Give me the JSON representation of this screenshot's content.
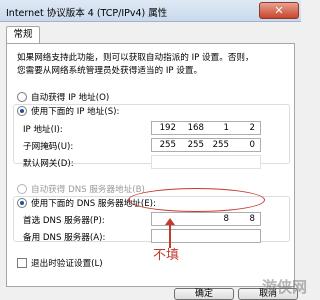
{
  "window": {
    "title": "Internet 协议版本 4 (TCP/IPv4) 属性",
    "close_glyph": "✕"
  },
  "tabs": [
    {
      "label": "常规"
    }
  ],
  "description": {
    "line1": "如果网络支持此功能，则可以获取自动指派的 IP 设置。否则，",
    "line2": "您需要从网络系统管理员处获得适当的 IP 设置。"
  },
  "ip_section": {
    "auto_label": "自动获得 IP 地址(O)",
    "manual_label": "使用下面的 IP 地址(S):",
    "selected": "manual",
    "fields": [
      {
        "label": "IP 地址(I):",
        "octets": [
          "192",
          "168",
          "1",
          "2"
        ]
      },
      {
        "label": "子网掩码(U):",
        "octets": [
          "255",
          "255",
          "255",
          "0"
        ]
      },
      {
        "label": "默认网关(D):",
        "octets": [
          "",
          "",
          "",
          ""
        ]
      }
    ]
  },
  "dns_section": {
    "auto_label": "自动获得 DNS 服务器地址(B)",
    "manual_label": "使用下面的 DNS 服务器地址(E):",
    "selected": "manual",
    "fields": [
      {
        "label": "首选 DNS 服务器(P):",
        "octets": [
          "",
          "",
          "8",
          "8"
        ]
      },
      {
        "label": "备用 DNS 服务器(A):",
        "octets": [
          "",
          "",
          "",
          ""
        ]
      }
    ]
  },
  "validate_on_exit": {
    "label": "退出时验证设置(L)",
    "checked": false
  },
  "buttons": {
    "ok": "确定",
    "cancel": "取消"
  },
  "annotation": {
    "text": "不填",
    "color": "#c43a2e"
  },
  "watermark": "游侠网"
}
